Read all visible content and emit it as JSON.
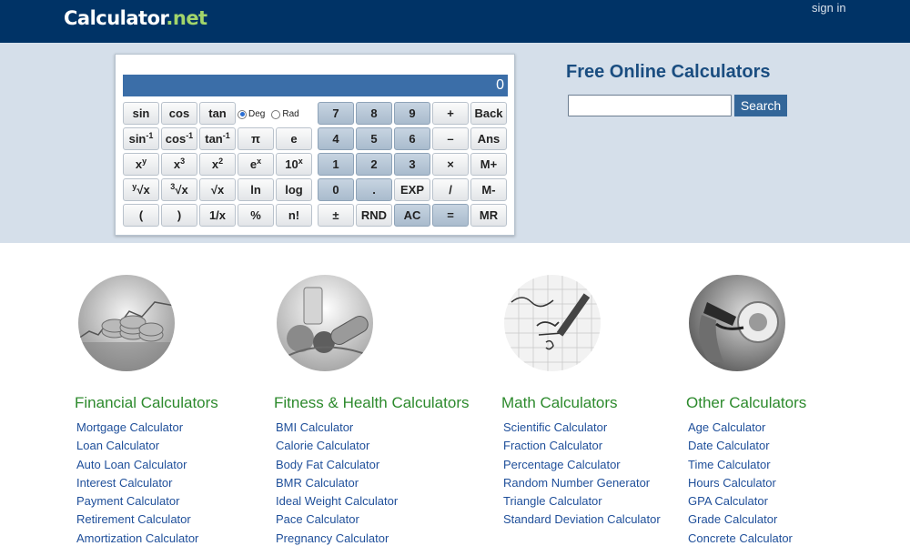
{
  "header": {
    "logo_main": "Calculator",
    "logo_tld": ".net",
    "sign_in": "sign in"
  },
  "calculator": {
    "display": "0",
    "deg_label": "Deg",
    "rad_label": "Rad",
    "angle_mode": "Deg"
  },
  "hero": {
    "title": "Free Online Calculators",
    "search_placeholder": "",
    "search_button": "Search"
  },
  "categories": [
    {
      "title": "Financial Calculators",
      "image": "coins-icon",
      "links": [
        "Mortgage Calculator",
        "Loan Calculator",
        "Auto Loan Calculator",
        "Interest Calculator",
        "Payment Calculator",
        "Retirement Calculator",
        "Amortization Calculator"
      ]
    },
    {
      "title": "Fitness & Health Calculators",
      "image": "fitness-icon",
      "links": [
        "BMI Calculator",
        "Calorie Calculator",
        "Body Fat Calculator",
        "BMR Calculator",
        "Ideal Weight Calculator",
        "Pace Calculator",
        "Pregnancy Calculator"
      ]
    },
    {
      "title": "Math Calculators",
      "image": "math-formula-icon",
      "links": [
        "Scientific Calculator",
        "Fraction Calculator",
        "Percentage Calculator",
        "Random Number Generator",
        "Triangle Calculator",
        "Standard Deviation Calculator"
      ]
    },
    {
      "title": "Other Calculators",
      "image": "fuel-pump-icon",
      "links": [
        "Age Calculator",
        "Date Calculator",
        "Time Calculator",
        "Hours Calculator",
        "GPA Calculator",
        "Grade Calculator",
        "Concrete Calculator"
      ]
    }
  ],
  "colors": {
    "header_bg": "#003366",
    "band_bg": "#d5dfea",
    "category_title": "#2d8a2d",
    "link": "#1f4f9a",
    "display_bg": "#3b6ea8"
  }
}
